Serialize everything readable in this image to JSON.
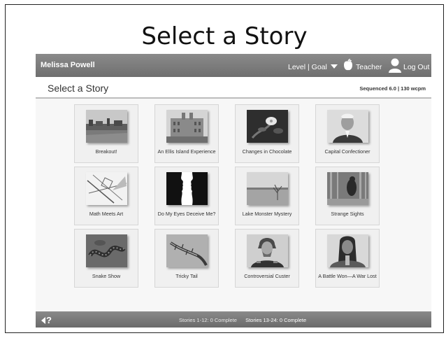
{
  "slide": {
    "title": "Select a Story"
  },
  "topbar": {
    "user_name": "Melissa Powell",
    "level_goal": "Level | Goal",
    "teacher": "Teacher",
    "logout": "Log Out"
  },
  "subheader": {
    "title": "Select a Story",
    "info": "Sequenced 6.0 | 130 wcpm"
  },
  "stories": [
    {
      "title": "Breakout!",
      "icon": "harbor-photo"
    },
    {
      "title": "An Ellis Island Experience",
      "icon": "building-photo"
    },
    {
      "title": "Changes in Chocolate",
      "icon": "cocoa-flower-photo"
    },
    {
      "title": "Capital Confectioner",
      "icon": "portrait-photo"
    },
    {
      "title": "Math Meets Art",
      "icon": "geometric-art-photo"
    },
    {
      "title": "Do My Eyes Deceive Me?",
      "icon": "face-vase-illusion"
    },
    {
      "title": "Lake Monster Mystery",
      "icon": "lake-photo"
    },
    {
      "title": "Strange Sights",
      "icon": "forest-creature-photo"
    },
    {
      "title": "Snake Show",
      "icon": "snake-photo"
    },
    {
      "title": "Tricky Tail",
      "icon": "lizard-photo"
    },
    {
      "title": "Controversial Custer",
      "icon": "portrait-photo"
    },
    {
      "title": "A Battle Won—A War Lost",
      "icon": "portrait-photo"
    }
  ],
  "footer": {
    "help": "?",
    "stories_1_12": "Stories 1-12: 0 Complete",
    "stories_13_24": "Stories 13-24: 0 Complete"
  }
}
